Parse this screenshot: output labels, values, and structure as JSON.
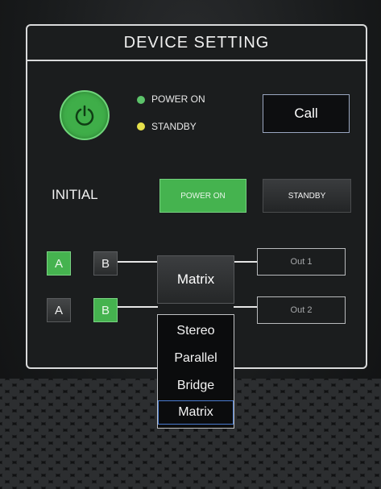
{
  "panel": {
    "title": "DEVICE SETTING"
  },
  "power": {
    "icon": "power-icon",
    "status": [
      {
        "label": "POWER ON",
        "color": "#5cc36a"
      },
      {
        "label": "STANDBY",
        "color": "#e5e04b"
      }
    ],
    "call_label": "Call"
  },
  "initial": {
    "label": "INITIAL",
    "power_on_label": "POWER ON",
    "standby_label": "STANDBY",
    "selected": "POWER ON"
  },
  "routing": {
    "row1": {
      "a_label": "A",
      "b_label": "B",
      "selected": "A",
      "output": "Out 1"
    },
    "row2": {
      "a_label": "A",
      "b_label": "B",
      "selected": "B",
      "output": "Out 2"
    },
    "mode_button": "Matrix"
  },
  "mode_dropdown": {
    "options": [
      "Stereo",
      "Parallel",
      "Bridge",
      "Matrix"
    ],
    "selected": "Matrix"
  },
  "colors": {
    "active_green": "#45b34f",
    "selected_outline": "#4a7bd0"
  }
}
